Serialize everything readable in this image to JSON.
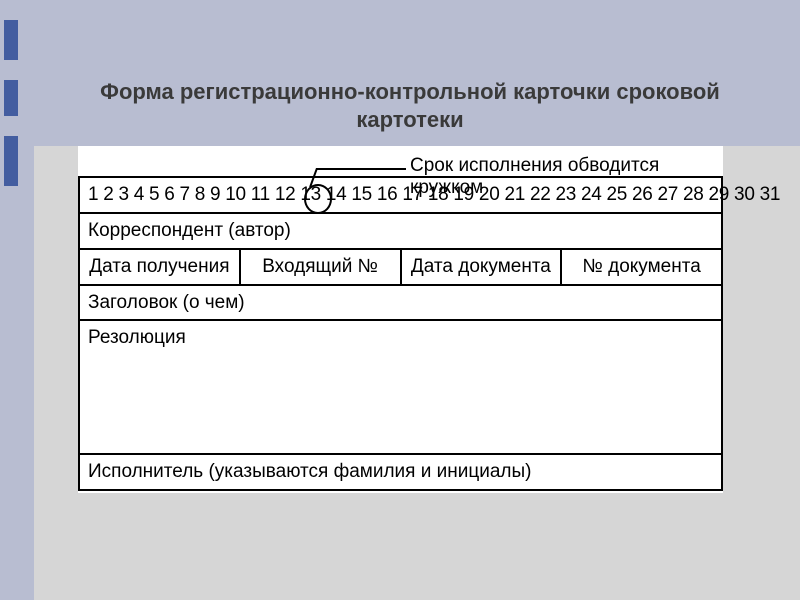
{
  "title": "Форма регистрационно-контрольной карточки сроковой картотеки",
  "annotation": "Срок исполнения обводится кружком",
  "numbers_row": "1 2 3 4 5 6 7 8 9 10 11 12 13 14 15 16 17 18 19 20 21 22 23 24 25 26 27 28 29 30 31",
  "circled_number": "13",
  "rows": {
    "correspondent": "Корреспондент (автор)",
    "date_received": "Дата получения",
    "incoming_no": "Входящий №",
    "doc_date": "Дата документа",
    "doc_no": "№ документа",
    "subject": "Заголовок (о чем)",
    "resolution": "Резолюция",
    "executor": "Исполнитель (указываются фамилия и инициалы)"
  }
}
